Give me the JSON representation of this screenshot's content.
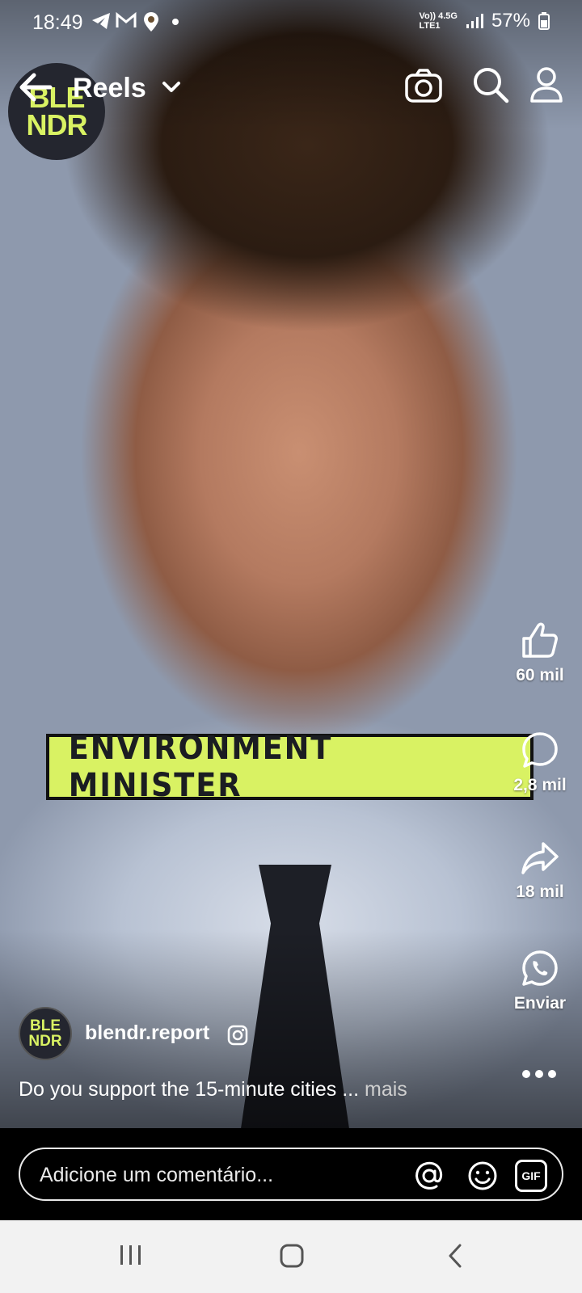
{
  "status_bar": {
    "time": "18:49",
    "network_top": "Vo)) 4.5G",
    "network_bottom": "LTE1",
    "battery": "57%"
  },
  "header": {
    "title": "Reels",
    "logo_line1": "BLE",
    "logo_line2": "NDR"
  },
  "video": {
    "banner_text": "ENVIRONMENT MINISTER"
  },
  "actions": {
    "likes": "60 mil",
    "comments": "2,8 mil",
    "shares": "18 mil",
    "send_label": "Enviar"
  },
  "post": {
    "avatar_line1": "BLE",
    "avatar_line2": "NDR",
    "author": "blendr.report",
    "caption": "Do you support the 15-minute cities ... ",
    "caption_more": "mais"
  },
  "comment_bar": {
    "placeholder": "Adicione um comentário...",
    "gif_label": "GIF"
  },
  "colors": {
    "brand_accent": "#d9f263",
    "nav_bar": "#f2f2f2"
  },
  "icons": [
    "arrow-back-icon",
    "chevron-down-icon",
    "camera-icon",
    "search-icon",
    "profile-icon",
    "thumbs-up-icon",
    "comment-icon",
    "share-icon",
    "whatsapp-icon",
    "more-icon",
    "instagram-icon",
    "mention-icon",
    "emoji-icon",
    "gif-icon",
    "recent-apps-icon",
    "home-icon",
    "back-icon"
  ]
}
